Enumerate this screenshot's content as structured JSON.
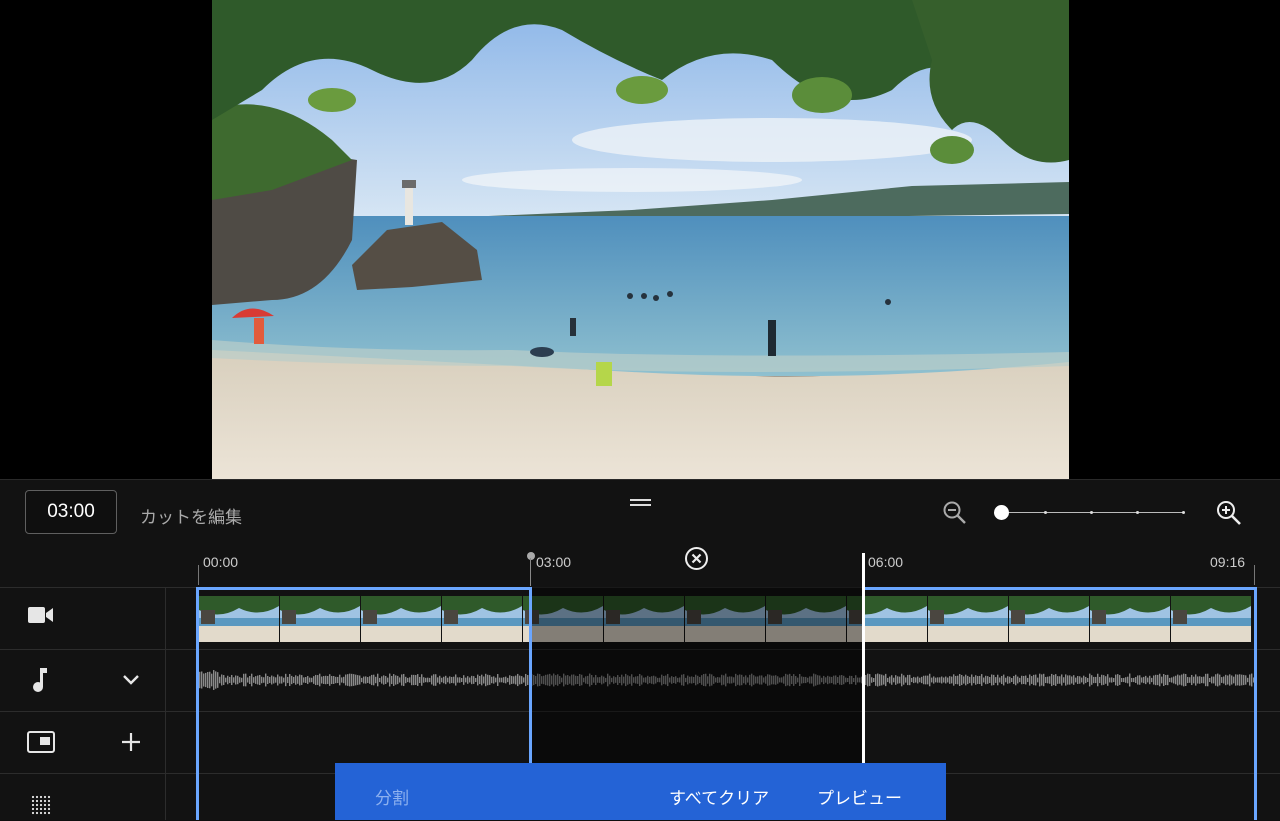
{
  "editor": {
    "current_time": "03:00",
    "edit_cut_label": "カットを編集"
  },
  "ruler": {
    "labels": [
      "00:00",
      "03:00",
      "06:00",
      "09:16"
    ]
  },
  "actions": {
    "split": "分割",
    "clear_all": "すべてクリア",
    "preview": "プレビュー"
  },
  "colors": {
    "selection": "#6aa6ff",
    "action_bar": "#2463d6"
  },
  "icons": {
    "video_track": "video-camera-icon",
    "audio_track": "music-note-icon",
    "overlay_track": "picture-in-picture-icon",
    "pattern_track": "dot-grid-icon"
  }
}
